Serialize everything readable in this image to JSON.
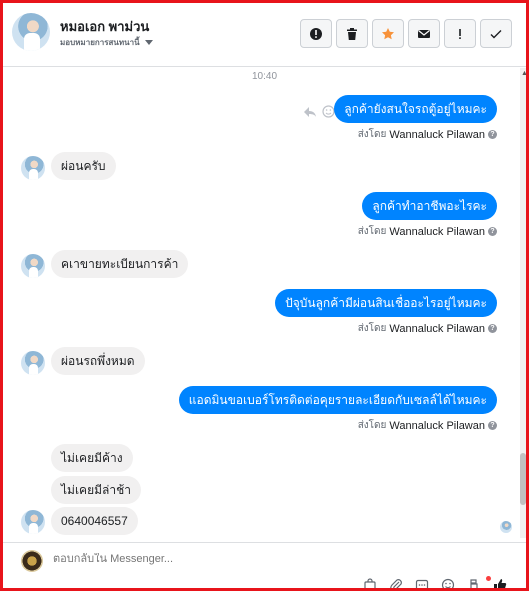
{
  "header": {
    "name": "หมอเอก พาม่วน",
    "assignment": "มอบหมายการสนทนานี้",
    "actions": [
      {
        "name": "report-button",
        "icon": "exclamation-circle-icon"
      },
      {
        "name": "delete-button",
        "icon": "trash-icon"
      },
      {
        "name": "star-button",
        "icon": "star-icon"
      },
      {
        "name": "mark-unread-button",
        "icon": "envelope-icon"
      },
      {
        "name": "spam-button",
        "icon": "exclamation-icon"
      },
      {
        "name": "done-button",
        "icon": "check-icon"
      }
    ]
  },
  "conversation": {
    "timestamp": "10:40",
    "sent_by_prefix": "ส่งโดย",
    "sender_name": "Wannaluck Pilawan",
    "messages": [
      {
        "dir": "out",
        "text": "ลูกค้ายังสนใจรถตู้อยู่ไหมคะ"
      },
      {
        "dir": "in",
        "text": "ผ่อนครับ"
      },
      {
        "dir": "out",
        "text": "ลูกค้าทำอาชีพอะไรคะ"
      },
      {
        "dir": "in",
        "text": "คเาขายทะเบียนการค้า"
      },
      {
        "dir": "out",
        "text": "ปัจุบันลูกค้ามีผ่อนสินเชื่ออะไรอยู่ไหมคะ"
      },
      {
        "dir": "in",
        "text": "ผ่อนรถพึ่งหมด"
      },
      {
        "dir": "out",
        "text": "แอดมินขอเบอร์โทรติดต่อคุยรายละเอียดกับเซลล์ได้ไหมคะ"
      },
      {
        "dir": "in",
        "text": "ไม่เคยมีค้าง"
      },
      {
        "dir": "in",
        "text": "ไม่เคยมีล่าช้า"
      },
      {
        "dir": "in",
        "text": "0640046557"
      }
    ]
  },
  "composer": {
    "placeholder": "ตอบกลับใน Messenger...",
    "tools": [
      "shopping-bag-icon",
      "paperclip-icon",
      "saved-replies-icon",
      "emoji-icon",
      "appointment-icon",
      "like-icon"
    ]
  },
  "colors": {
    "accent": "#0084ff",
    "incoming_bubble": "#f1f0f0",
    "frame_border": "#e8141b",
    "star": "#f7923a"
  }
}
